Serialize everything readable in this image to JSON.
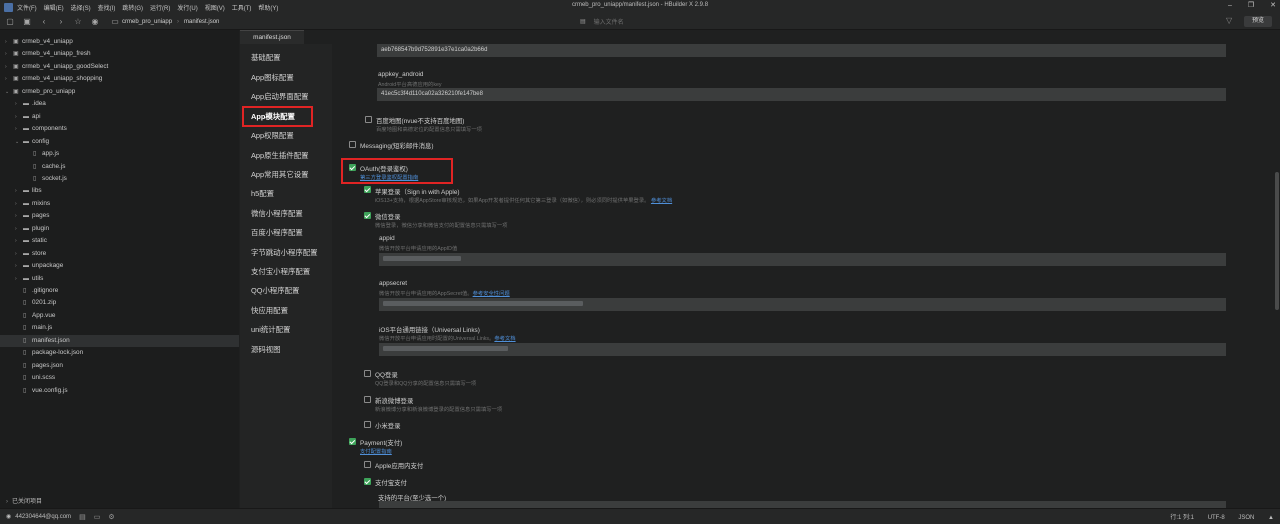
{
  "window": {
    "title": "crmeb_pro_uniapp/manifest.json - HBuilder X 2.9.8",
    "menu": [
      "文件(F)",
      "编辑(E)",
      "选择(S)",
      "查找(I)",
      "跳转(G)",
      "运行(R)",
      "发行(U)",
      "视图(V)",
      "工具(T)",
      "帮助(Y)"
    ],
    "controls": [
      "–",
      "❐",
      "✕"
    ]
  },
  "toolbar": {
    "breadcrumb": [
      "crmeb_pro_uniapp",
      "manifest.json"
    ],
    "search_placeholder": "输入文件名",
    "preview_label": "预览"
  },
  "sidebar": {
    "items": [
      {
        "label": "crmeb_v4_uniapp",
        "depth": 0,
        "type": "project",
        "open": false
      },
      {
        "label": "crmeb_v4_uniapp_fresh",
        "depth": 0,
        "type": "project",
        "open": false
      },
      {
        "label": "crmeb_v4_uniapp_goodSelect",
        "depth": 0,
        "type": "project",
        "open": false
      },
      {
        "label": "crmeb_v4_uniapp_shopping",
        "depth": 0,
        "type": "project",
        "open": false
      },
      {
        "label": "crmeb_pro_uniapp",
        "depth": 0,
        "type": "project",
        "open": true
      },
      {
        "label": ".idea",
        "depth": 1,
        "type": "folder",
        "open": false
      },
      {
        "label": "api",
        "depth": 1,
        "type": "folder",
        "open": false
      },
      {
        "label": "components",
        "depth": 1,
        "type": "folder",
        "open": false
      },
      {
        "label": "config",
        "depth": 1,
        "type": "folder",
        "open": true
      },
      {
        "label": "app.js",
        "depth": 2,
        "type": "file"
      },
      {
        "label": "cache.js",
        "depth": 2,
        "type": "file"
      },
      {
        "label": "socket.js",
        "depth": 2,
        "type": "file"
      },
      {
        "label": "libs",
        "depth": 1,
        "type": "folder",
        "open": false
      },
      {
        "label": "mixins",
        "depth": 1,
        "type": "folder",
        "open": false
      },
      {
        "label": "pages",
        "depth": 1,
        "type": "folder",
        "open": false
      },
      {
        "label": "plugin",
        "depth": 1,
        "type": "folder",
        "open": false
      },
      {
        "label": "static",
        "depth": 1,
        "type": "folder",
        "open": false
      },
      {
        "label": "store",
        "depth": 1,
        "type": "folder",
        "open": false
      },
      {
        "label": "unpackage",
        "depth": 1,
        "type": "folder",
        "open": false
      },
      {
        "label": "utils",
        "depth": 1,
        "type": "folder",
        "open": false
      },
      {
        "label": ".gitignore",
        "depth": 1,
        "type": "file"
      },
      {
        "label": "0201.zip",
        "depth": 1,
        "type": "file"
      },
      {
        "label": "App.vue",
        "depth": 1,
        "type": "file"
      },
      {
        "label": "main.js",
        "depth": 1,
        "type": "file"
      },
      {
        "label": "manifest.json",
        "depth": 1,
        "type": "file",
        "selected": true
      },
      {
        "label": "package-lock.json",
        "depth": 1,
        "type": "file"
      },
      {
        "label": "pages.json",
        "depth": 1,
        "type": "file"
      },
      {
        "label": "uni.scss",
        "depth": 1,
        "type": "file"
      },
      {
        "label": "vue.config.js",
        "depth": 1,
        "type": "file"
      }
    ],
    "closed_projects": "已关闭项目"
  },
  "editor": {
    "tab_label": "manifest.json"
  },
  "nav": {
    "items": [
      "基础配置",
      "App图标配置",
      "App启动界面配置",
      "App模块配置",
      "App权限配置",
      "App原生插件配置",
      "App常用其它设置",
      "h5配置",
      "微信小程序配置",
      "百度小程序配置",
      "字节跳动小程序配置",
      "支付宝小程序配置",
      "QQ小程序配置",
      "快应用配置",
      "uni统计配置",
      "源码视图"
    ],
    "active_index": 3
  },
  "content": {
    "appkey_ios_value": "aeb768547b9d752891e37e1ca0a2b66d",
    "appkey_android_label": "appkey_android",
    "appkey_android_desc": "Android平台高德应用的key",
    "appkey_android_value": "41ec5c3f4d110ca02a326210fe147be8",
    "baidu_map_label": "百度地图(nvue不支持百度地图)",
    "baidu_map_desc": "百度地图和高德定位的配置信息只需填写一项",
    "messaging_label": "Messaging(短彩邮件消息)",
    "oauth_label": "OAuth(登录鉴权)",
    "oauth_link": "第三方登录鉴权配置指南",
    "apple_label": "苹果登录（Sign in with Apple)",
    "apple_desc": "iOS13+支持，根据AppStore审核规范，如果App开发者提供任何其它第三登录（如微信），则必须同时提供苹果登录。",
    "apple_link": "参考文档",
    "wechat_label": "微信登录",
    "wechat_desc": "微信登录，微信分享和微信支付的配置信息只需填写一项",
    "appid_label": "appid",
    "appid_desc": "微信开放平台申请应用的AppID值",
    "appsecret_label": "appsecret",
    "appsecret_desc": "微信开放平台申请应用的AppSecret值。",
    "appsecret_link": "参考安全性问题",
    "ul_label": "iOS平台通用链接（Universal Links)",
    "ul_desc": "微信开放平台申请应用时配置的Universal Links。",
    "ul_link": "参考文档",
    "qq_label": "QQ登录",
    "qq_desc": "QQ登录和QQ分享的配置信息只需填写一项",
    "weibo_label": "新浪微博登录",
    "weibo_desc": "新浪微博分享和新浪微博登录的配置信息只需填写一项",
    "xiaomi_label": "小米登录",
    "payment_label": "Payment(支付)",
    "payment_link": "支付配置指南",
    "apple_iap_label": "Apple应用内支付",
    "alipay_label": "支付宝支付",
    "platform_label": "支持的平台(至少选一个)"
  },
  "checks": {
    "baidu_map": false,
    "messaging": false,
    "oauth": true,
    "apple": true,
    "wechat": true,
    "qq": false,
    "weibo": false,
    "xiaomi": false,
    "payment": true,
    "apple_iap": false,
    "alipay": true
  },
  "status": {
    "account": "442304644@qq.com",
    "position": "行:1  列:1",
    "encoding": "UTF-8",
    "language": "JSON"
  },
  "colors": {
    "accent_red": "#e02424",
    "checkbox_green": "#3ea35a",
    "link_blue": "#4f8fd8"
  }
}
